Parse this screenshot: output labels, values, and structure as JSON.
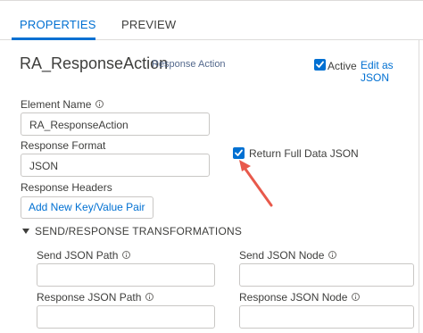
{
  "tabs": [
    {
      "label": "PROPERTIES",
      "active": true
    },
    {
      "label": "PREVIEW",
      "active": false
    }
  ],
  "header": {
    "title": "RA_ResponseAction",
    "subtitle": "Response Action",
    "active_label": "Active",
    "active_checked": true,
    "edit_json_label": "Edit as JSON"
  },
  "form": {
    "element_name_label": "Element Name",
    "element_name_value": "RA_ResponseAction",
    "response_format_label": "Response Format",
    "response_format_value": "JSON",
    "return_full_label": "Return Full Data JSON",
    "return_full_checked": true,
    "response_headers_label": "Response Headers",
    "add_pair_label": "Add New Key/Value Pair"
  },
  "transform": {
    "section_title": "SEND/RESPONSE TRANSFORMATIONS",
    "send_json_path_label": "Send JSON Path",
    "send_json_node_label": "Send JSON Node",
    "response_json_path_label": "Response JSON Path",
    "response_json_node_label": "Response JSON Node",
    "send_json_path_value": "",
    "send_json_node_value": "",
    "response_json_path_value": "",
    "response_json_node_value": ""
  },
  "colors": {
    "accent": "#0070d2",
    "annotation_arrow": "#e8594b"
  }
}
